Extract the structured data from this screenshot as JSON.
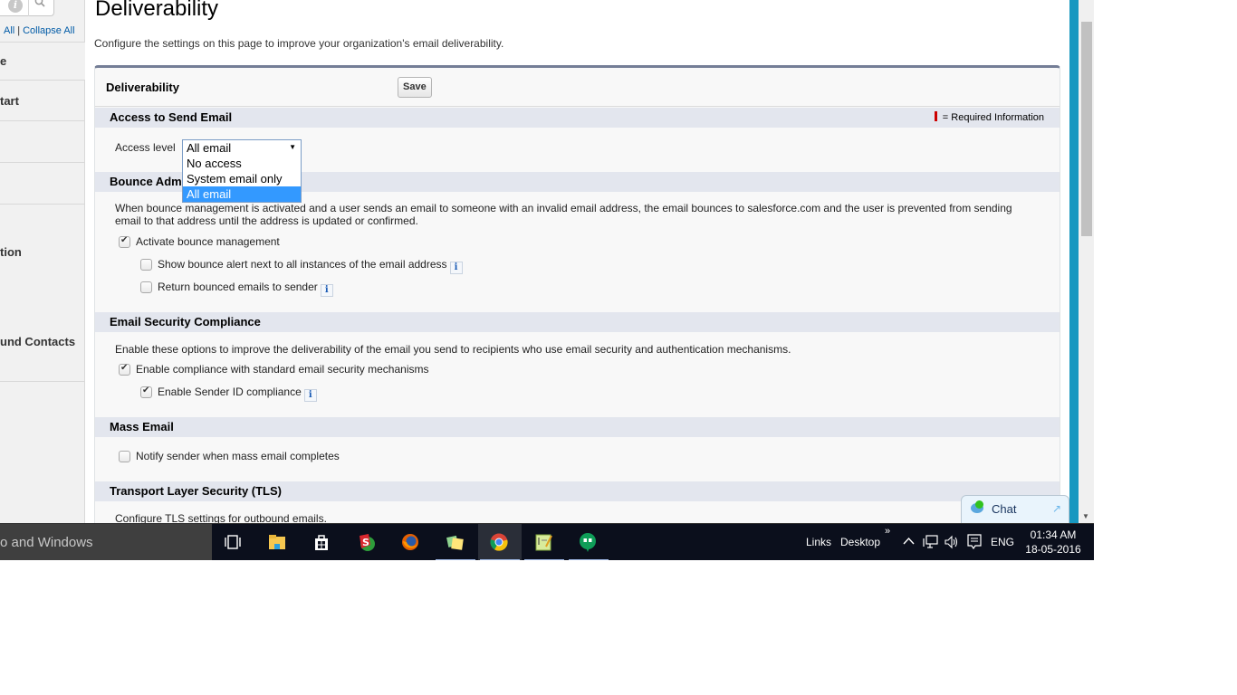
{
  "sidebar": {
    "links": {
      "expand": "All",
      "separator": "|",
      "collapse": "Collapse All"
    },
    "items": [
      {
        "label": "e"
      },
      {
        "label": "tart"
      },
      {
        "label": ""
      },
      {
        "label": ""
      },
      {
        "label": "tion"
      },
      {
        "label": "und Contacts"
      },
      {
        "label": ""
      }
    ]
  },
  "page": {
    "title": "Deliverability",
    "description": "Configure the settings on this page to improve your organization's email deliverability."
  },
  "panel": {
    "title": "Deliverability",
    "save_label": "Save",
    "required_info": "= Required Information"
  },
  "sections": {
    "access": {
      "title": "Access to Send Email",
      "field_label": "Access level",
      "selected": "All email",
      "options": [
        "No access",
        "System email only",
        "All email"
      ]
    },
    "bounce": {
      "title": "Bounce Administration",
      "title_visible": "Bounce Adm",
      "description_line1": "When bounce management is activated and a user sends an email to someone with an invalid email address, the email bounces to salesforce.com and the user is prevented from sending",
      "description_line2": "email to that address until the address is updated or confirmed.",
      "options": [
        {
          "label": "Activate bounce management",
          "checked": true
        },
        {
          "label": "Show bounce alert next to all instances of the email address",
          "checked": false
        },
        {
          "label": "Return bounced emails to sender",
          "checked": false
        }
      ]
    },
    "security": {
      "title": "Email Security Compliance",
      "description": "Enable these options to improve the deliverability of the email you send to recipients who use email security and authentication mechanisms.",
      "options": [
        {
          "label": "Enable compliance with standard email security mechanisms",
          "checked": true
        },
        {
          "label": "Enable Sender ID compliance",
          "checked": true
        }
      ]
    },
    "mass": {
      "title": "Mass Email",
      "options": [
        {
          "label": "Notify sender when mass email completes",
          "checked": false
        }
      ]
    },
    "tls": {
      "title": "Transport Layer Security (TLS)",
      "description": "Configure TLS settings for outbound emails."
    }
  },
  "chat": {
    "label": "Chat"
  },
  "taskbar": {
    "search_text": "o and Windows",
    "apps": [
      "task-view",
      "file-explorer",
      "store",
      "app-s",
      "firefox",
      "sticky-notes",
      "chrome",
      "notepad",
      "hangouts"
    ],
    "tray": {
      "links": "Links",
      "desktop": "Desktop",
      "more": "»",
      "language": "ENG"
    },
    "time": "01:34 AM",
    "date": "18-05-2016"
  },
  "colors": {
    "accent": "#1797c0",
    "selection": "#3399ff",
    "section_bg": "#e3e6ee",
    "required": "#cc0000"
  }
}
